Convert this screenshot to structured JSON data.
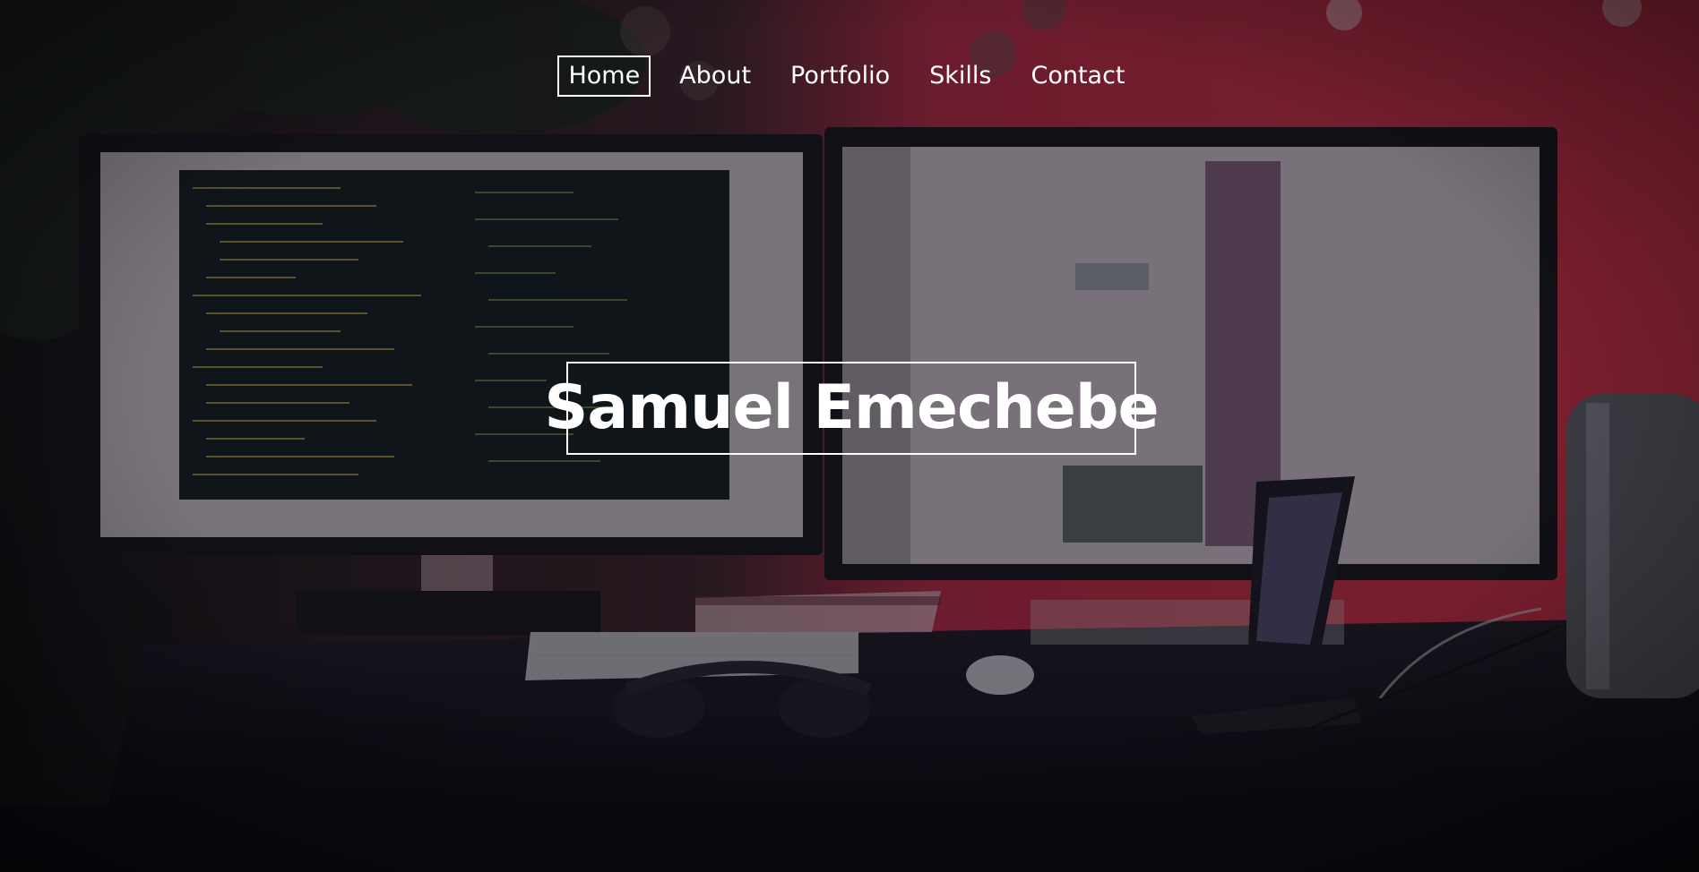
{
  "nav": {
    "items": [
      {
        "label": "Home",
        "active": true
      },
      {
        "label": "About",
        "active": false
      },
      {
        "label": "Portfolio",
        "active": false
      },
      {
        "label": "Skills",
        "active": false
      },
      {
        "label": "Contact",
        "active": false
      }
    ]
  },
  "hero": {
    "title": "Samuel Emechebe",
    "background": "dim photo of a desk with two monitors showing code, keyboard, headphones and phone against a red wall"
  },
  "colors": {
    "text": "#ffffff",
    "wall": "#c02a3e",
    "overlay": "#0a0a10"
  }
}
